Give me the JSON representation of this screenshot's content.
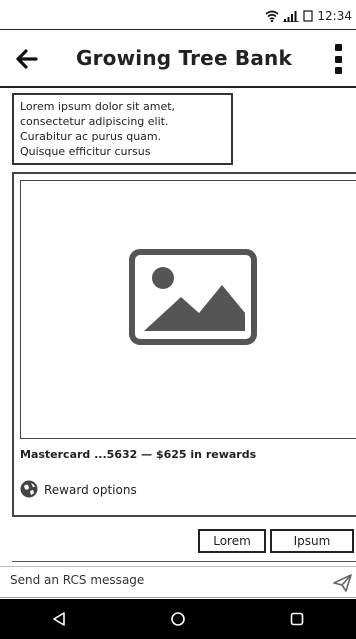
{
  "status_bar": {
    "time": "12:34",
    "icons": [
      "wifi-icon",
      "signal-icon",
      "battery-icon"
    ]
  },
  "app_bar": {
    "title": "Growing Tree Bank",
    "back_icon": "back-arrow-icon",
    "menu_icon": "more-vertical-icon"
  },
  "message": {
    "text": "Lorem ipsum dolor sit amet,\nconsectetur adipiscing elit.\nCurabitur ac purus quam.\nQuisque efficitur cursus"
  },
  "card": {
    "media_icon": "image-placeholder-icon",
    "title": "Mastercard ...5632 — $625 in rewards",
    "action": {
      "icon": "globe-icon",
      "label": "Reward options"
    }
  },
  "suggested_replies": [
    {
      "label": "Lorem"
    },
    {
      "label": "Ipsum"
    }
  ],
  "composer": {
    "placeholder": "Send an RCS message",
    "send_icon": "send-icon"
  },
  "nav_bar": {
    "icons": [
      "back-triangle-icon",
      "home-circle-icon",
      "recents-square-icon"
    ]
  },
  "colors": {
    "text": "#222222",
    "nav_background": "#000000",
    "surface": "#ffffff"
  }
}
